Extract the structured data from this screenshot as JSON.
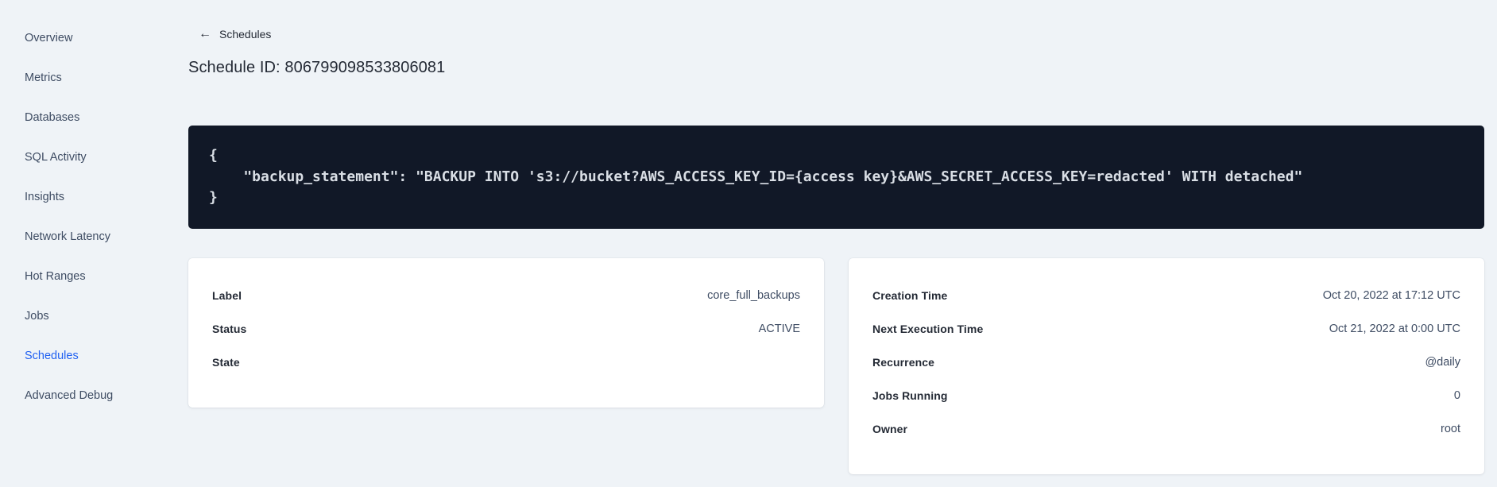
{
  "colors": {
    "page_bg": "#eff3f7",
    "sidebar_text": "#3e4c63",
    "sidebar_active": "#2161f2",
    "code_bg": "#111827",
    "code_text": "#d9dee5",
    "card_bg": "#ffffff",
    "heading_text": "#242a35"
  },
  "sidebar": {
    "items": [
      {
        "label": "Overview"
      },
      {
        "label": "Metrics"
      },
      {
        "label": "Databases"
      },
      {
        "label": "SQL Activity"
      },
      {
        "label": "Insights"
      },
      {
        "label": "Network Latency"
      },
      {
        "label": "Hot Ranges"
      },
      {
        "label": "Jobs"
      },
      {
        "label": "Schedules"
      },
      {
        "label": "Advanced Debug"
      }
    ],
    "active_item": "Schedules"
  },
  "header": {
    "back_icon": "←",
    "back_label": "Schedules",
    "title": "Schedule ID: 806799098533806081"
  },
  "code_block": {
    "lines": [
      "{",
      "    \"backup_statement\": \"BACKUP INTO 's3://bucket?AWS_ACCESS_KEY_ID={access key}&AWS_SECRET_ACCESS_KEY=redacted' WITH detached\"",
      "}"
    ]
  },
  "details_left": {
    "rows": [
      {
        "label": "Label",
        "value": "core_full_backups"
      },
      {
        "label": "Status",
        "value": "ACTIVE"
      },
      {
        "label": "State",
        "value": ""
      }
    ]
  },
  "details_right": {
    "rows": [
      {
        "label": "Creation Time",
        "value": "Oct 20, 2022 at 17:12 UTC"
      },
      {
        "label": "Next Execution Time",
        "value": "Oct 21, 2022 at 0:00 UTC"
      },
      {
        "label": "Recurrence",
        "value": "@daily"
      },
      {
        "label": "Jobs Running",
        "value": "0"
      },
      {
        "label": "Owner",
        "value": "root"
      }
    ]
  }
}
